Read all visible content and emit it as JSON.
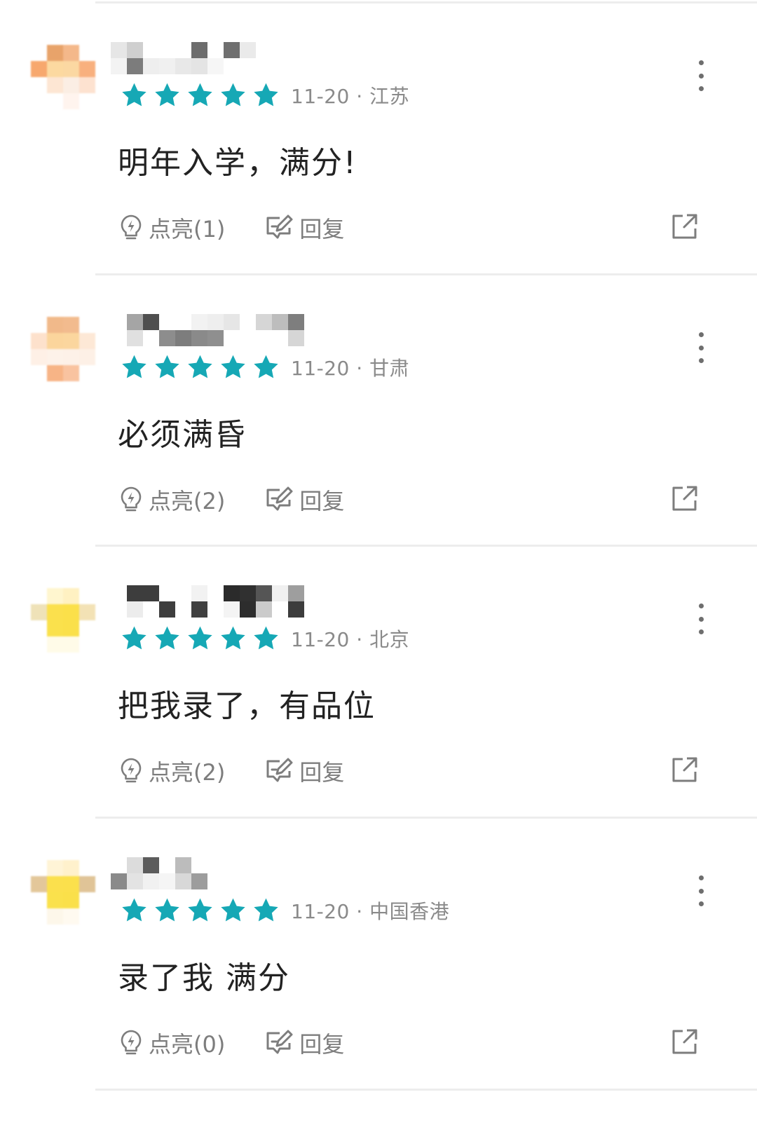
{
  "colors": {
    "star": "#16a8b5",
    "icon_gray": "#7d7d7d",
    "divider": "#ededed"
  },
  "comments": [
    {
      "date": "11-20",
      "sep": " · ",
      "region": "江苏",
      "stars": 5,
      "text": "明年入学，满分!",
      "like_label": "点亮(1)",
      "reply_label": "回复",
      "avatar": [
        "#ffffff",
        "#e8a36a",
        "#f4b88a",
        "#ffffff",
        "#f7a86e",
        "#fcd9a0",
        "#fbd8a2",
        "#f8b07e",
        "#ffffff",
        "#fde6d3",
        "#fbeee4",
        "#fde2d0",
        "#ffffff",
        "#ffffff",
        "#fff4ee",
        "#ffffff"
      ],
      "user_blocks": [
        "#e6e6e6",
        "#f3f3f3",
        "#cfcfcf",
        "#7c7c7c",
        "#ffffff",
        "#eeeeee",
        "#ffffff",
        "#f0f0f0",
        "#ffffff",
        "#e8e8e8",
        "#6d6d6d",
        "#e4e4e4",
        "#ffffff",
        "#f6f6f6",
        "#6f6f6f",
        "#ffffff",
        "#eaeaea",
        "#ffffff",
        "#ffffff",
        "#ffffff"
      ]
    },
    {
      "date": "11-20",
      "sep": " · ",
      "region": "甘肃",
      "stars": 5,
      "text": "必须满昏",
      "like_label": "点亮(2)",
      "reply_label": "回复",
      "avatar": [
        "#ffffff",
        "#f1b98a",
        "#f2bb8e",
        "#ffffff",
        "#fde1cc",
        "#fbd59c",
        "#fbd69e",
        "#fde8d6",
        "#fef0e6",
        "#fdf2e9",
        "#fdf1e8",
        "#fdf0e6",
        "#ffffff",
        "#f7b486",
        "#f9c3a0",
        "#ffffff"
      ],
      "user_blocks": [
        "#ffffff",
        "#ffffff",
        "#a5a5a5",
        "#e0e0e0",
        "#4f4f4f",
        "#ffffff",
        "#ffffff",
        "#8d8d8d",
        "#ffffff",
        "#7d7d7d",
        "#f2f2f2",
        "#8a8a8a",
        "#eeeeee",
        "#8f8f8f",
        "#e6e6e6",
        "#ffffff",
        "#ffffff",
        "#ffffff",
        "#d6d6d6",
        "#ffffff",
        "#bdbdbd",
        "#ffffff",
        "#7e7e7e",
        "#d6d6d6"
      ]
    },
    {
      "date": "11-20",
      "sep": " · ",
      "region": "北京",
      "stars": 5,
      "text": "把我录了，有品位",
      "like_label": "点亮(2)",
      "reply_label": "回复",
      "avatar": [
        "#ffffff",
        "#fff6cf",
        "#fff1c2",
        "#ffffff",
        "#efe2b8",
        "#fbe04d",
        "#fbe04a",
        "#f3e2b5",
        "#ffffff",
        "#fae14c",
        "#fae04a",
        "#ffffff",
        "#ffffff",
        "#fffbe8",
        "#fffbe8",
        "#ffffff"
      ],
      "user_blocks": [
        "#ffffff",
        "#ffffff",
        "#3d3d3d",
        "#ececec",
        "#3d3d3d",
        "#ffffff",
        "#ffffff",
        "#3e3e3e",
        "#ffffff",
        "#ffffff",
        "#f2f2f2",
        "#404040",
        "#ffffff",
        "#ffffff",
        "#2b2b2b",
        "#f4f4f4",
        "#303030",
        "#2d2d2d",
        "#555555",
        "#cbcbcb",
        "#f0f0f0",
        "#ffffff",
        "#9e9e9e",
        "#3c3c3c"
      ]
    },
    {
      "date": "11-20",
      "sep": " · ",
      "region": "中国香港",
      "stars": 5,
      "text": "录了我 满分",
      "like_label": "点亮(0)",
      "reply_label": "回复",
      "avatar": [
        "#ffffff",
        "#fff4d6",
        "#fff1cc",
        "#ffffff",
        "#e3c79a",
        "#fbe04d",
        "#fbe04c",
        "#e0c497",
        "#ffffff",
        "#fae14c",
        "#fae04a",
        "#ffffff",
        "#ffffff",
        "#fdf7ea",
        "#fffaf0",
        "#ffffff"
      ],
      "user_blocks": [
        "#ffffff",
        "#8a8a8a",
        "#dcdcdc",
        "#e3e3e3",
        "#5c5c5c",
        "#f1f1f1",
        "#ffffff",
        "#f5f5f5",
        "#bcbcbc",
        "#d8d8d8",
        "#ffffff",
        "#9d9d9d"
      ]
    }
  ]
}
